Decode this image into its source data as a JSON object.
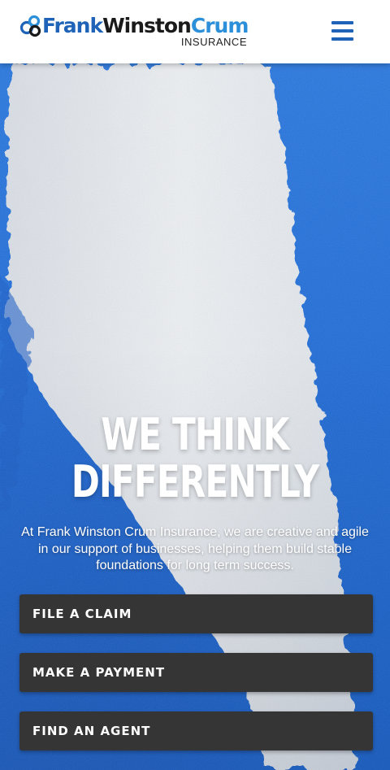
{
  "header": {
    "logo": {
      "frank": "Frank",
      "winston": "Winston",
      "crum": "Crum",
      "sub": "INSURANCE"
    },
    "menu_icon": "hamburger-menu-icon"
  },
  "hero": {
    "headline_line1": "WE THINK",
    "headline_line2": "DIFFERENTLY",
    "intro": "At Frank Winston Crum Insurance, we are creative and agile in our support of businesses, helping them build stable foundations for long term success."
  },
  "actions": [
    {
      "label": "FILE A CLAIM"
    },
    {
      "label": "MAKE A PAYMENT"
    },
    {
      "label": "FIND AN AGENT"
    }
  ],
  "colors": {
    "brand_blue": "#1f63b8",
    "light_blue": "#2c8fd9",
    "hero_blue": "#1f6fd6",
    "button_bg": "#353535"
  }
}
